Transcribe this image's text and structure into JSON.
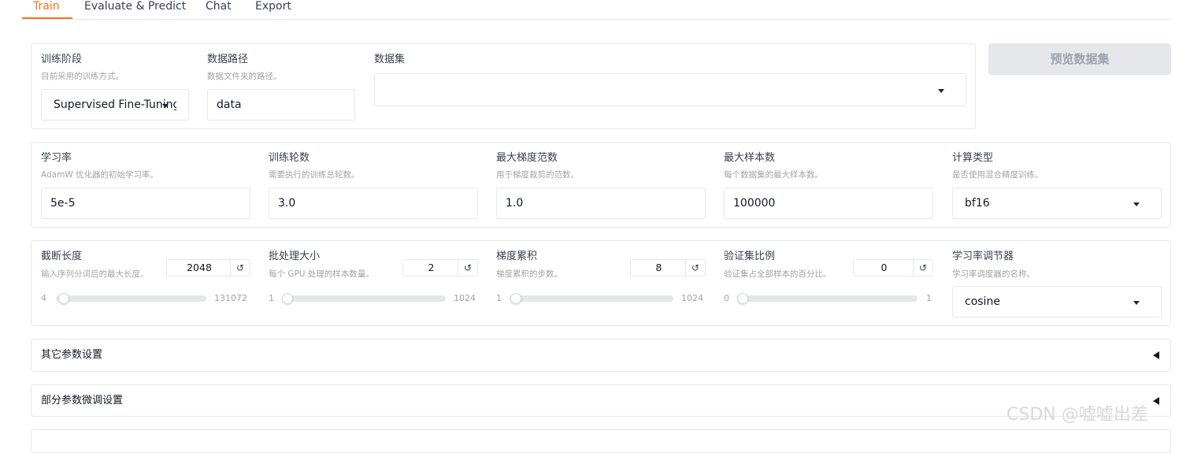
{
  "tabs": [
    {
      "label": "Train",
      "active": true
    },
    {
      "label": "Evaluate & Predict"
    },
    {
      "label": "Chat"
    },
    {
      "label": "Export"
    }
  ],
  "row1": {
    "stage": {
      "label": "训练阶段",
      "info": "目前采用的训练方式。",
      "value": "Supervised Fine-Tuning"
    },
    "dataset_dir": {
      "label": "数据路径",
      "info": "数据文件夹的路径。",
      "value": "data"
    },
    "dataset": {
      "label": "数据集",
      "value": ""
    },
    "preview_button": "预览数据集"
  },
  "row2": {
    "learning_rate": {
      "label": "学习率",
      "info": "AdamW 优化器的初始学习率。",
      "value": "5e-5"
    },
    "num_epochs": {
      "label": "训练轮数",
      "info": "需要执行的训练总轮数。",
      "value": "3.0"
    },
    "max_grad_norm": {
      "label": "最大梯度范数",
      "info": "用于梯度裁剪的范数。",
      "value": "1.0"
    },
    "max_samples": {
      "label": "最大样本数",
      "info": "每个数据集的最大样本数。",
      "value": "100000"
    },
    "compute_type": {
      "label": "计算类型",
      "info": "是否使用混合精度训练。",
      "value": "bf16"
    }
  },
  "row3": {
    "cutoff_len": {
      "label": "截断长度",
      "info": "输入序列分词后的最大长度。",
      "value": "2048",
      "min": "4",
      "max": "131072",
      "fraction": 0.0156
    },
    "batch_size": {
      "label": "批处理大小",
      "info": "每个 GPU 处理的样本数量。",
      "value": "2",
      "min": "1",
      "max": "1024",
      "fraction": 0.001
    },
    "grad_accum": {
      "label": "梯度累积",
      "info": "梯度累积的步数。",
      "value": "8",
      "min": "1",
      "max": "1024",
      "fraction": 0.0068
    },
    "val_size": {
      "label": "验证集比例",
      "info": "验证集占全部样本的百分比。",
      "value": "0",
      "min": "0",
      "max": "1",
      "fraction": 0
    },
    "lr_scheduler": {
      "label": "学习率调节器",
      "info": "学习率调度器的名称。",
      "value": "cosine"
    },
    "reset_icon": "↺"
  },
  "accordions": {
    "other_params": "其它参数设置",
    "freeze_params": "部分参数微调设置"
  },
  "watermark": "CSDN @嘘嘘出差"
}
